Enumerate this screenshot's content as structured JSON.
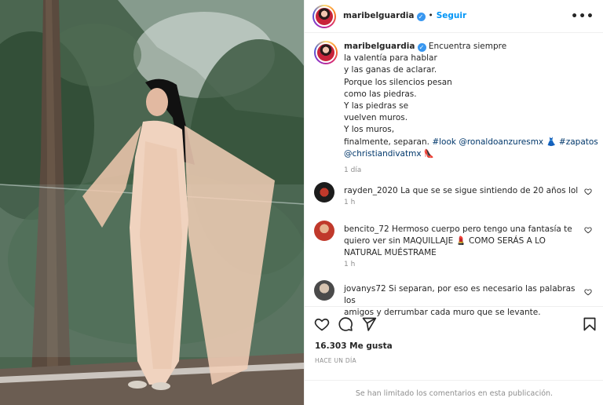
{
  "post": {
    "author": "maribelguardia",
    "follow_label": "Seguir",
    "more_label": "•••",
    "caption": {
      "lines": [
        "Encuentra siempre",
        "la valentía para hablar",
        "y las ganas de aclarar.",
        "Porque los silencios pesan",
        "como las piedras.",
        "Y las piedras se",
        "vuelven muros.",
        "Y los muros,"
      ],
      "line9_prefix": "finalmente, separan. ",
      "hashtag_look": "#look",
      "mention_ronaldo": "@ronaldoanzuresmx",
      "emoji_dress": "👗",
      "hashtag_zapatos": "#zapatos",
      "mention_christian": "@christiandivatmx",
      "emoji_shoe": "👠",
      "time": "1 día"
    }
  },
  "comments": [
    {
      "user": "rayden_2020",
      "text": "La que se se sigue sintiendo de 20 años lol",
      "time": "1 h"
    },
    {
      "user": "bencito_72",
      "text_line1": "Hermoso cuerpo pero tengo una fantasía te",
      "text_line2": "quiero ver sin MAQUILLAJE 💄 COMO SERÁS A LO",
      "text_line3": "NATURAL MUÉSTRAME",
      "time": "1 h"
    },
    {
      "user": "jovanys72",
      "text_line1": "Si separan, por eso es necesario las palabras los",
      "text_line2": "amigos y derrumbar cada muro que se levante."
    }
  ],
  "footer": {
    "likes": "16.303 Me gusta",
    "ago": "HACE UN DÍA",
    "limited": "Se han limitado los comentarios en esta publicación."
  },
  "icons": [
    "heart-icon",
    "comment-icon",
    "share-icon",
    "bookmark-icon",
    "verified-icon",
    "more-icon"
  ],
  "colors": {
    "link": "#00376b",
    "follow": "#0095f6",
    "verified": "#3897f0",
    "muted": "#8e8e8e"
  }
}
